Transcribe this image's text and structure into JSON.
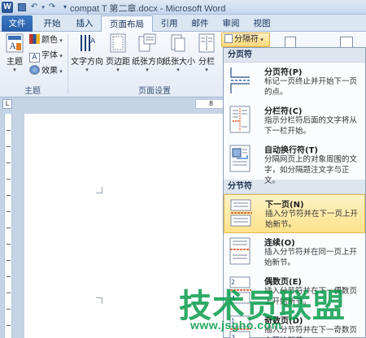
{
  "title_bar": {
    "doc_title": "compat T 第二章.docx - Microsoft Word"
  },
  "tabs": [
    "文件",
    "开始",
    "插入",
    "页面布局",
    "引用",
    "邮件",
    "审阅",
    "视图"
  ],
  "ribbon": {
    "theme_group": {
      "theme_label": "主题",
      "colors_label": "颜色",
      "fonts_label": "字体",
      "effects_label": "效果",
      "group_label": "主题"
    },
    "page_setup": {
      "text_direction": "文字方向",
      "margins": "页边距",
      "orientation": "纸张方向",
      "size": "纸张大小",
      "columns": "分栏",
      "group_label": "页面设置"
    },
    "breaks_button": "分隔符"
  },
  "ruler": {
    "corner": "L",
    "h_mark": "8"
  },
  "breaks_menu": {
    "page_breaks_header": "分页符",
    "section_breaks_header": "分节符",
    "items": [
      {
        "title": "分页符(P)",
        "desc": "标记一页终止并开始下一页的点。"
      },
      {
        "title": "分栏符(C)",
        "desc": "指示分栏符后面的文字将从下一栏开始。"
      },
      {
        "title": "自动换行符(T)",
        "desc": "分隔网页上的对象周围的文字，如分隔题注文字与正文。"
      },
      {
        "title": "下一页(N)",
        "desc": "插入分节符并在下一页上开始新节。"
      },
      {
        "title": "连续(O)",
        "desc": "插入分节符并在同一页上开始新节。"
      },
      {
        "title": "偶数页(E)",
        "desc": "插入分节符并在下一偶数页上开始新节。"
      },
      {
        "title": "奇数页(D)",
        "desc": "插入分节符并在下一奇数页上开始新节。"
      }
    ]
  },
  "watermark": {
    "text": "技术员联盟",
    "url": "www.jsgho.com"
  },
  "colors": {
    "file_tab": "#2a5fa8",
    "highlight": "#fde28b",
    "watermark": "#009944"
  }
}
